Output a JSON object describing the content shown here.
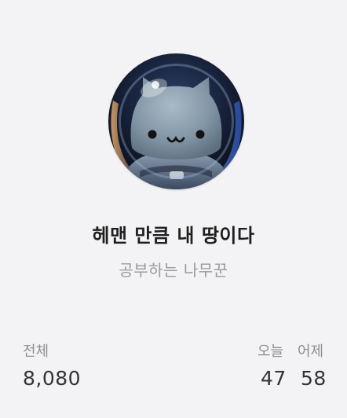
{
  "profile": {
    "blog_title": "헤맨 만큼 내 땅이다",
    "nickname": "공부하는 나무꾼",
    "avatar_icon": "astronaut-cat-avatar-icon"
  },
  "stats": {
    "total_label": "전체",
    "total_value": "8,080",
    "today_label": "오늘",
    "today_value": "47",
    "yesterday_label": "어제",
    "yesterday_value": "58"
  },
  "colors": {
    "background": "#f3f3f5",
    "title": "#1f1f1f",
    "nickname": "#9a9a9e",
    "stat_label": "#8e8e93",
    "stat_value": "#333333"
  }
}
